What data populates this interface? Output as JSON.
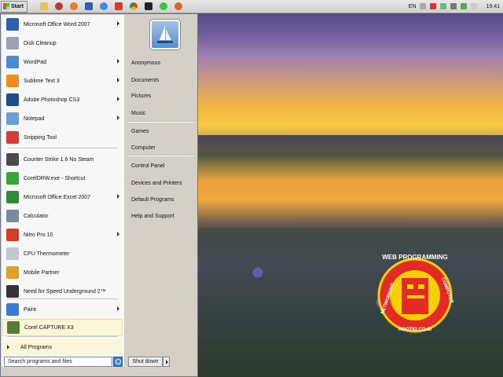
{
  "taskbar": {
    "start_label": "Start",
    "language": "EN",
    "clock": "19:41",
    "quick_launch": [
      "folder-icon",
      "media-icon",
      "firefox-icon",
      "word-icon",
      "ie-icon",
      "chrome-icon",
      "chrome-icon",
      "vlc-icon",
      "clock-icon",
      "firefox-icon"
    ]
  },
  "programs": [
    {
      "label": "Microsoft Office Word 2007",
      "icon": "word-icon",
      "color": "#2f5fb0",
      "submenu": true
    },
    {
      "label": "Disk Cleanup",
      "icon": "disk-cleanup-icon",
      "color": "#9aa3ad",
      "submenu": false
    },
    {
      "label": "WordPad",
      "icon": "wordpad-icon",
      "color": "#4b8bd4",
      "submenu": true
    },
    {
      "label": "Sublime Text 3",
      "icon": "sublime-icon",
      "color": "#ef8c1a",
      "submenu": true
    },
    {
      "label": "Adobe Photoshop CS3",
      "icon": "photoshop-icon",
      "color": "#1c4f8a",
      "submenu": true
    },
    {
      "label": "Notepad",
      "icon": "notepad-icon",
      "color": "#6aa0d8",
      "submenu": true
    },
    {
      "label": "Snipping Tool",
      "icon": "snipping-tool-icon",
      "color": "#d33a3a",
      "submenu": false
    },
    {
      "label": "Counter Strike 1.6 No Steam",
      "icon": "counter-strike-icon",
      "color": "#4a4a4a",
      "submenu": false
    },
    {
      "label": "CorelDRW.exe - Shortcut",
      "icon": "coreldraw-icon",
      "color": "#3aa53a",
      "submenu": false
    },
    {
      "label": "Microsoft Office Excel 2007",
      "icon": "excel-icon",
      "color": "#2f8a3a",
      "submenu": true
    },
    {
      "label": "Calculator",
      "icon": "calculator-icon",
      "color": "#7a8a9a",
      "submenu": false
    },
    {
      "label": "Nitro Pro 10",
      "icon": "nitro-icon",
      "color": "#d83a2a",
      "submenu": true
    },
    {
      "label": "CPU Thermometer",
      "icon": "thermometer-icon",
      "color": "#c0c8d0",
      "submenu": false
    },
    {
      "label": "Mobile Partner",
      "icon": "mobile-partner-icon",
      "color": "#e0a020",
      "submenu": false
    },
    {
      "label": "Need for Speed Underground 2™",
      "icon": "nfs-icon",
      "color": "#333333",
      "submenu": false
    },
    {
      "label": "Paint",
      "icon": "paint-icon",
      "color": "#3a7ad0",
      "submenu": true
    },
    {
      "label": "Corel CAPTURE X3",
      "icon": "corel-capture-icon",
      "color": "#5a7a3a",
      "submenu": false
    }
  ],
  "all_programs_label": "All Programs",
  "search_placeholder": "Search programs and files",
  "right_links": {
    "group1": [
      "Anonymous",
      "Documents",
      "Pictures",
      "Music"
    ],
    "group2": [
      "Games",
      "Computer"
    ],
    "group3": [
      "Control Panel",
      "Devices and Printers",
      "Default Programs",
      "Help and Support"
    ]
  },
  "shutdown_label": "Shut down",
  "watermark": {
    "top_text": "WEB PROGRAMMING",
    "left_text": "NETWORKING",
    "right_text": "COMPUTER",
    "bottom_text": "ROOT93.CO.ID"
  }
}
